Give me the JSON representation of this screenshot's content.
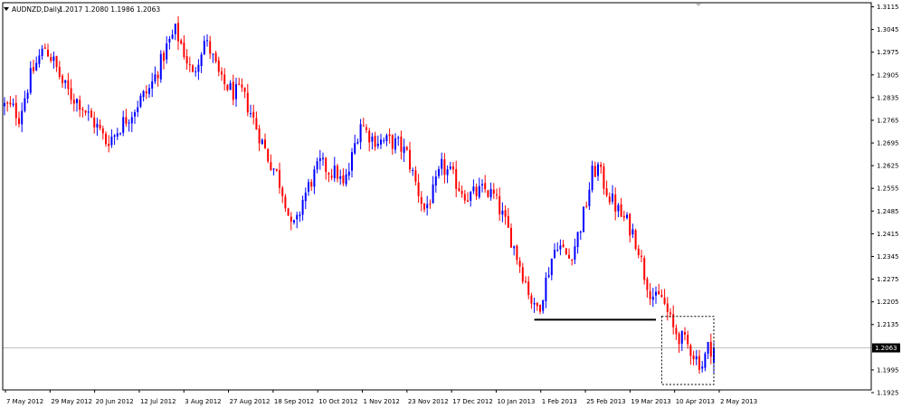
{
  "header": {
    "symbol": "AUDNZD,Daily",
    "ohlc": "1.2017 1.2080 1.1986 1.2063"
  },
  "colors": {
    "bull": "#0000ff",
    "bear": "#ff0000",
    "level_line": "#000000",
    "price_line": "#c0c0c0",
    "box": "#000000"
  },
  "chart_data": {
    "type": "candlestick",
    "symbol": "AUDNZD",
    "timeframe": "Daily",
    "y_ticks": [
      1.3115,
      1.3045,
      1.2975,
      1.2905,
      1.2835,
      1.2765,
      1.2695,
      1.2625,
      1.2555,
      1.2485,
      1.2415,
      1.2345,
      1.2275,
      1.2205,
      1.2135,
      1.1995,
      1.1925
    ],
    "y_range": [
      1.1925,
      1.3115
    ],
    "x_ticks": [
      "7 May 2012",
      "29 May 2012",
      "20 Jun 2012",
      "12 Jul 2012",
      "3 Aug 2012",
      "27 Aug 2012",
      "18 Sep 2012",
      "10 Oct 2012",
      "1 Nov 2012",
      "23 Nov 2012",
      "17 Dec 2012",
      "10 Jan 2013",
      "1 Feb 2013",
      "25 Feb 2013",
      "19 Mar 2013",
      "10 Apr 2013",
      "2 May 2013"
    ],
    "current_price": 1.2063,
    "last_bar": {
      "open": 1.2017,
      "high": 1.208,
      "low": 1.1986,
      "close": 1.2063
    },
    "close_path": [
      [
        0,
        1.281
      ],
      [
        3,
        1.28
      ],
      [
        5,
        1.2775
      ],
      [
        9,
        1.29
      ],
      [
        12,
        1.296
      ],
      [
        14,
        1.299
      ],
      [
        17,
        1.2945
      ],
      [
        20,
        1.288
      ],
      [
        23,
        1.284
      ],
      [
        26,
        1.282
      ],
      [
        29,
        1.278
      ],
      [
        32,
        1.2745
      ],
      [
        35,
        1.27
      ],
      [
        38,
        1.272
      ],
      [
        41,
        1.276
      ],
      [
        44,
        1.279
      ],
      [
        47,
        1.283
      ],
      [
        50,
        1.286
      ],
      [
        53,
        1.292
      ],
      [
        56,
        1.299
      ],
      [
        59,
        1.304
      ],
      [
        61,
        1.3
      ],
      [
        63,
        1.295
      ],
      [
        65,
        1.29
      ],
      [
        67,
        1.296
      ],
      [
        69,
        1.301
      ],
      [
        71,
        1.298
      ],
      [
        73,
        1.293
      ],
      [
        75,
        1.288
      ],
      [
        77,
        1.287
      ],
      [
        79,
        1.285
      ],
      [
        82,
        1.285
      ],
      [
        85,
        1.279
      ],
      [
        88,
        1.272
      ],
      [
        91,
        1.265
      ],
      [
        94,
        1.26
      ],
      [
        97,
        1.252
      ],
      [
        99,
        1.243
      ],
      [
        101,
        1.245
      ],
      [
        103,
        1.252
      ],
      [
        106,
        1.258
      ],
      [
        109,
        1.263
      ],
      [
        112,
        1.261
      ],
      [
        115,
        1.26
      ],
      [
        117,
        1.256
      ],
      [
        119,
        1.261
      ],
      [
        121,
        1.269
      ],
      [
        123,
        1.276
      ],
      [
        125,
        1.273
      ],
      [
        127,
        1.271
      ],
      [
        130,
        1.27
      ],
      [
        133,
        1.27
      ],
      [
        136,
        1.269
      ],
      [
        139,
        1.266
      ],
      [
        142,
        1.257
      ],
      [
        145,
        1.249
      ],
      [
        148,
        1.254
      ],
      [
        151,
        1.262
      ],
      [
        154,
        1.26
      ],
      [
        157,
        1.256
      ],
      [
        160,
        1.253
      ],
      [
        163,
        1.254
      ],
      [
        166,
        1.255
      ],
      [
        169,
        1.253
      ],
      [
        172,
        1.247
      ],
      [
        175,
        1.24
      ],
      [
        178,
        1.232
      ],
      [
        181,
        1.224
      ],
      [
        183,
        1.218
      ],
      [
        185,
        1.22
      ],
      [
        187,
        1.227
      ],
      [
        189,
        1.234
      ],
      [
        191,
        1.239
      ],
      [
        193,
        1.236
      ],
      [
        195,
        1.234
      ],
      [
        197,
        1.238
      ],
      [
        199,
        1.244
      ],
      [
        201,
        1.251
      ],
      [
        203,
        1.26
      ],
      [
        205,
        1.262
      ],
      [
        207,
        1.257
      ],
      [
        209,
        1.253
      ],
      [
        211,
        1.25
      ],
      [
        213,
        1.247
      ],
      [
        215,
        1.245
      ],
      [
        217,
        1.242
      ],
      [
        219,
        1.237
      ],
      [
        221,
        1.229
      ],
      [
        223,
        1.224
      ],
      [
        225,
        1.221
      ],
      [
        227,
        1.222
      ],
      [
        229,
        1.217
      ],
      [
        231,
        1.212
      ],
      [
        233,
        1.21
      ],
      [
        235,
        1.208
      ],
      [
        237,
        1.206
      ],
      [
        239,
        1.203
      ],
      [
        241,
        1.201
      ],
      [
        243,
        1.2063
      ]
    ],
    "annotations": [
      {
        "type": "horizontal-line",
        "price": 1.215,
        "from_bar": 183,
        "to_bar": 225
      },
      {
        "type": "dashed-box",
        "from_bar": 227,
        "to_bar": 245,
        "price_high": 1.216,
        "price_low": 1.195
      }
    ]
  }
}
